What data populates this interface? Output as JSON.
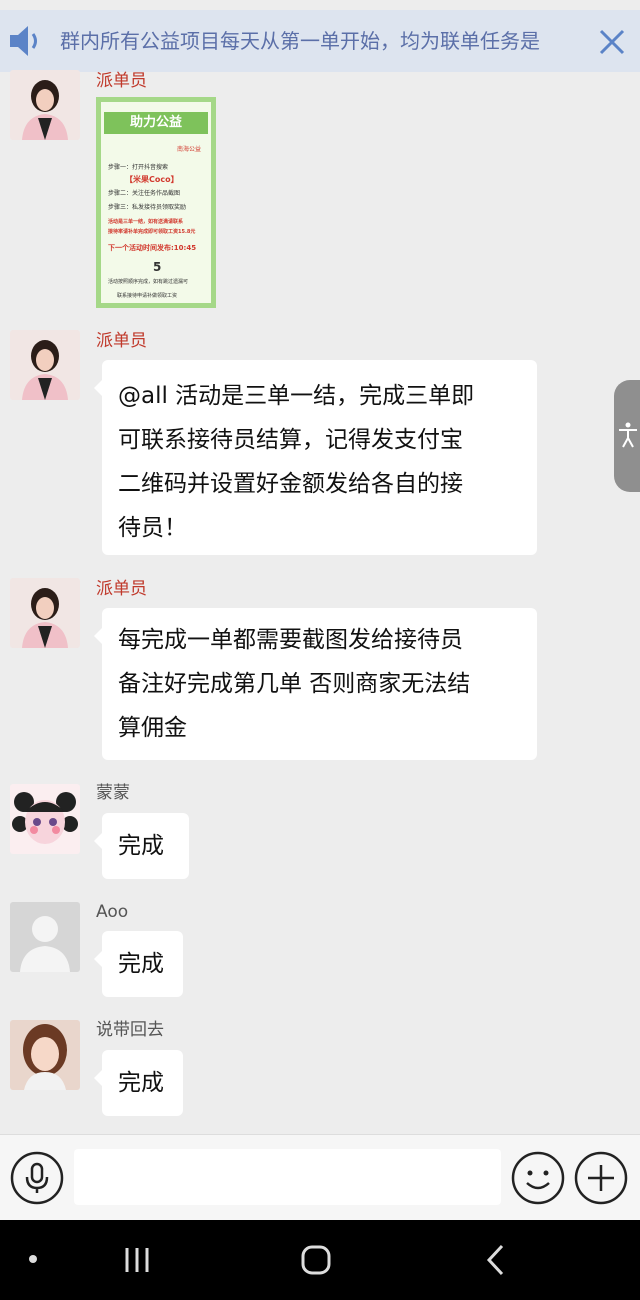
{
  "banner": {
    "text": "群内所有公益项目每天从第一单开始，均为联单任务是",
    "speaker_icon": "speaker-icon",
    "close_icon": "close-icon"
  },
  "poster": {
    "title": "助力公益",
    "badge": "南海公益",
    "step1": "步骤一：打开抖音搜索",
    "keyword": "【米果Coco】",
    "step2": "步骤二：关注任务作品截图",
    "step3": "步骤三：私发接待员领取奖励",
    "note1": "活动是三单一结，如有送满请联系",
    "note2": "接待率请补单完成即可领取工资15.8元",
    "next_time": "下一个活动时间发布:10:45",
    "number": "5",
    "note3": "活动按照顺序完成，如有跳过遗漏可",
    "footer": "联系接待申请补做领取工资"
  },
  "messages": [
    {
      "sender": "派单员"
    },
    {
      "sender": "派单员",
      "text": "@all 活动是三单一结，完成三单即可联系接待员结算，记得发支付宝二维码并设置好金额发给各自的接待员！"
    },
    {
      "sender": "派单员",
      "text": "每完成一单都需要截图发给接待员备注好完成第几单 否则商家无法结算佣金"
    },
    {
      "sender": "蒙蒙",
      "text": "完成"
    },
    {
      "sender": "Aoo",
      "text": "完成"
    },
    {
      "sender": "说带回去",
      "text": "完成"
    }
  ],
  "bubble_lines": {
    "m1": [
      "@all 活动是三单一结，完成三单即",
      "可联系接待员结算，记得发支付宝",
      "二维码并设置好金额发给各自的接",
      "待员！"
    ],
    "m2": [
      "每完成一单都需要截图发给接待员",
      "备注好完成第几单 否则商家无法结",
      "算佣金"
    ]
  },
  "input_bar": {
    "placeholder": "",
    "voice_icon": "microphone-icon",
    "emoji_icon": "emoji-icon",
    "plus_icon": "plus-icon"
  },
  "colors": {
    "sender_red": "#c0392b",
    "banner_text": "#5b6fa8",
    "banner_bg": "#dde4ef",
    "background": "#ededed"
  }
}
